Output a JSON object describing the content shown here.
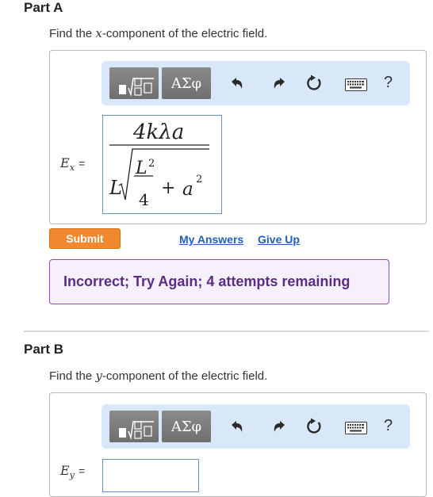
{
  "partA": {
    "title": "Part A",
    "prompt_pre": "Find the ",
    "prompt_var": "x",
    "prompt_post": "-component of the electric field.",
    "toolbar": {
      "greek_label": "ΑΣφ",
      "help_label": "?",
      "icons": [
        "templates-icon",
        "greek-letters-icon",
        "undo-icon",
        "redo-icon",
        "reset-icon",
        "keyboard-icon",
        "help-icon"
      ]
    },
    "lhs_var": "E",
    "lhs_sub": "x",
    "lhs_eq": "=",
    "answer": {
      "numerator": "4kλa",
      "radicand_frac_num": "L",
      "radicand_frac_num_exp": "2",
      "radicand_frac_den": "4",
      "plus": "+",
      "radicand_term": "a",
      "radicand_term_exp": "2",
      "outer_factor": "L"
    },
    "submit_label": "Submit",
    "my_answers_label": "My Answers",
    "give_up_label": "Give Up",
    "feedback": "Incorrect; Try Again; 4 attempts remaining"
  },
  "partB": {
    "title": "Part B",
    "prompt_pre": "Find the ",
    "prompt_var": "y",
    "prompt_post": "-component of the electric field.",
    "toolbar": {
      "greek_label": "ΑΣφ",
      "help_label": "?"
    },
    "lhs_var": "E",
    "lhs_sub": "y",
    "lhs_eq": "="
  },
  "colors": {
    "submit": "#f0892d",
    "link": "#1f5fb8",
    "feedback_border": "#8a4fb0",
    "feedback_text": "#5a2d82",
    "toolbar_bg": "#d9e8f9"
  }
}
